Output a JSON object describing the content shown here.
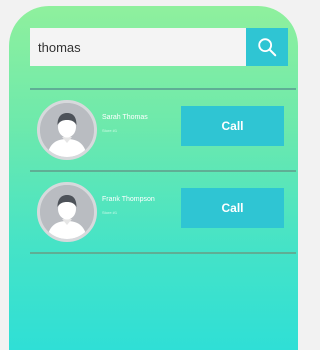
{
  "search": {
    "value": "thomas",
    "button_icon": "search-icon"
  },
  "contacts": [
    {
      "name": "Sarah Thomas",
      "subtitle": "Store #1",
      "call_label": "Call",
      "avatar_icon": "user-avatar-icon"
    },
    {
      "name": "Frank Thompson",
      "subtitle": "Store #1",
      "call_label": "Call",
      "avatar_icon": "user-avatar-icon"
    }
  ],
  "colors": {
    "accent": "#2fc5d3",
    "gradient_top": "#8ff09d",
    "gradient_bottom": "#2fdfd6",
    "divider": "#5fae95"
  }
}
